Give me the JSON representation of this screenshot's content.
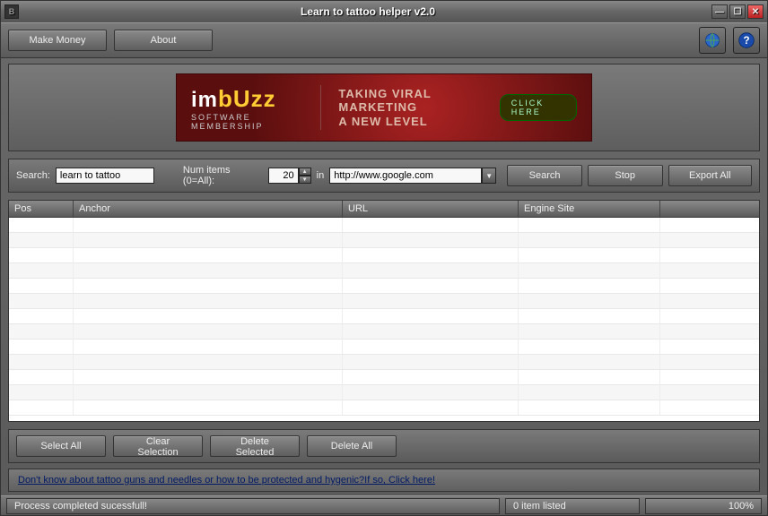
{
  "window": {
    "title": "Learn to tattoo helper v2.0"
  },
  "toolbar": {
    "make_money": "Make Money",
    "about": "About"
  },
  "banner": {
    "brand_prefix": "im",
    "brand_suffix": "bUzz",
    "subtitle": "SOFTWARE MEMBERSHIP",
    "headline1": "TAKING VIRAL MARKETING",
    "headline2": "A NEW LEVEL",
    "cta": "CLICK HERE"
  },
  "searchbar": {
    "search_label": "Search:",
    "search_value": "learn to tattoo",
    "num_label": "Num items (0=All):",
    "num_value": "20",
    "in_label": "in",
    "engine_value": "http://www.google.com",
    "search_btn": "Search",
    "stop_btn": "Stop",
    "export_btn": "Export All"
  },
  "table": {
    "headers": {
      "pos": "Pos",
      "anchor": "Anchor",
      "url": "URL",
      "engine": "Engine Site"
    },
    "rows": []
  },
  "actions": {
    "select_all": "Select All",
    "clear_selection": "Clear Selection",
    "delete_selected": "Delete Selected",
    "delete_all": "Delete All"
  },
  "promo_link": "Don't know about tattoo guns and needles or how to be protected and hygenic?If so, Click here!",
  "status": {
    "message": "Process completed sucessfull!",
    "count": "0 item listed",
    "progress": "100%"
  }
}
